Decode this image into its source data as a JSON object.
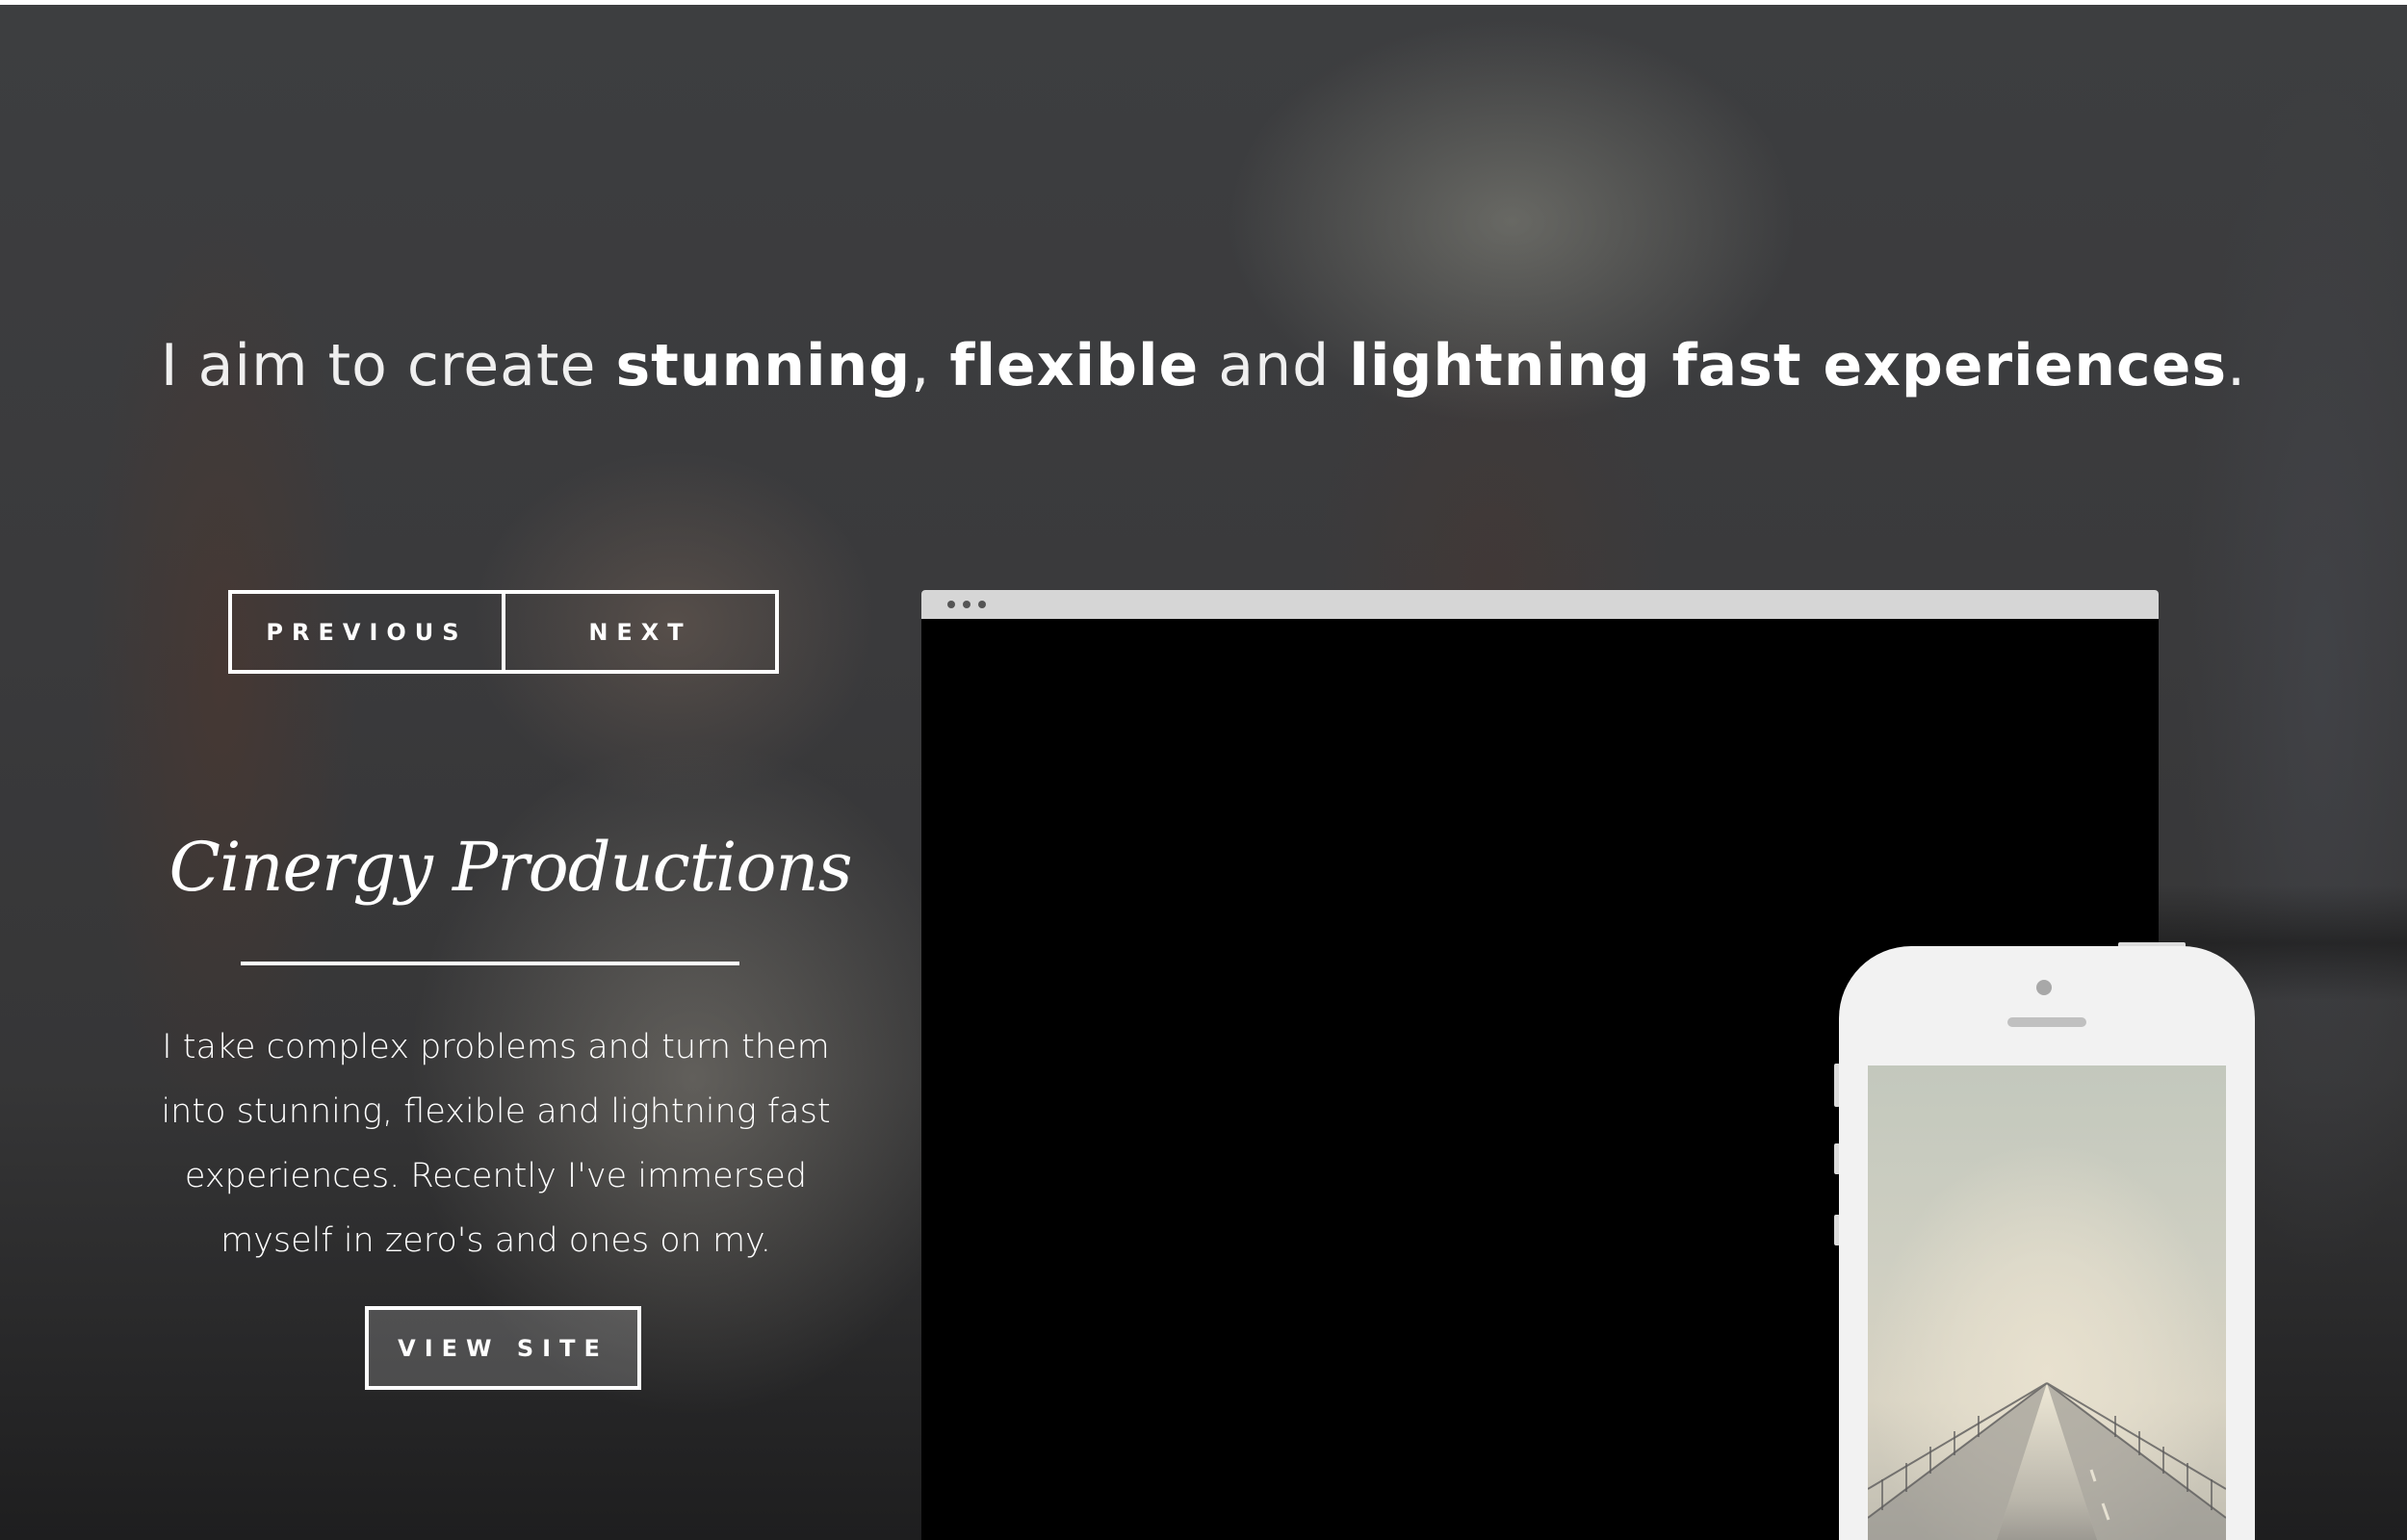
{
  "headline": {
    "part1": "I aim to create ",
    "bold1": "stunning",
    "part2": ", ",
    "bold2": "flexible",
    "part3": " and ",
    "bold3": "lightning fast experiences",
    "part4": "."
  },
  "pager": {
    "previous_label": "PREVIOUS",
    "next_label": "NEXT"
  },
  "project": {
    "title": "Cinergy Productions",
    "description": "I take complex problems and turn them into stunning, flexible and lightning fast experiences. Recently I've immersed myself in zero's and ones on my.",
    "view_site_label": "VIEW SITE"
  },
  "colors": {
    "text": "#ffffff",
    "browser_bar": "#d6d6d6",
    "browser_screen": "#000000",
    "phone_body": "#f2f2f2"
  },
  "icons": {
    "browser_controls": "browser-dots-icon",
    "phone_camera": "camera-icon",
    "phone_speaker": "speaker-icon"
  }
}
